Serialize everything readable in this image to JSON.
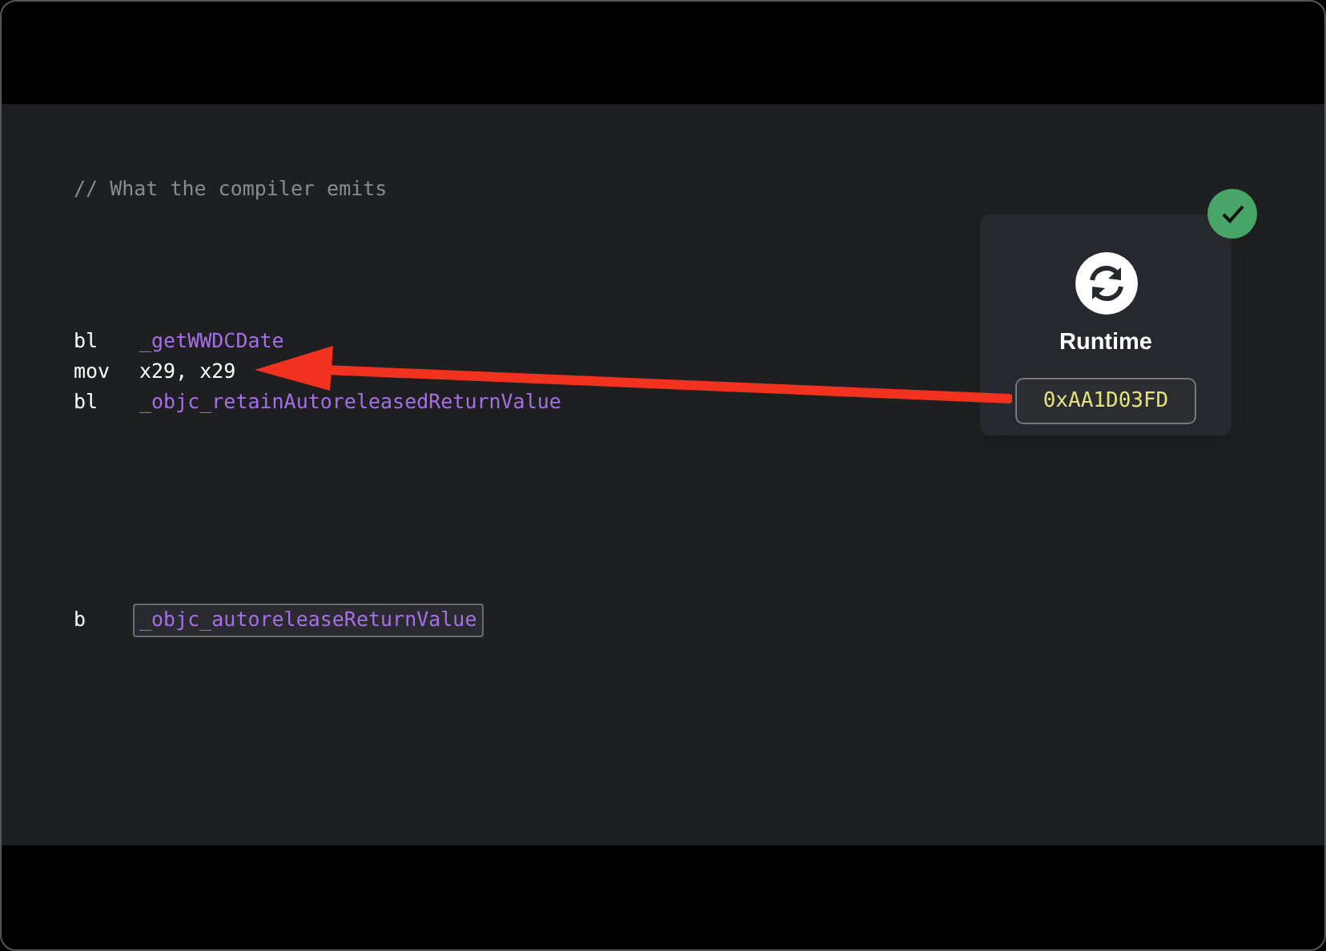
{
  "comment": "// What the compiler emits",
  "code_blocks": [
    {
      "lines": [
        {
          "mnemonic": "bl",
          "operand": "_getWWDCDate",
          "kind": "symbol",
          "highlighted": false
        },
        {
          "mnemonic": "mov",
          "operand": "x29, x29",
          "kind": "register",
          "highlighted": false
        },
        {
          "mnemonic": "bl",
          "operand": "_objc_retainAutoreleasedReturnValue",
          "kind": "symbol",
          "highlighted": false
        }
      ]
    },
    {
      "lines": [
        {
          "mnemonic": "b",
          "operand": "_objc_autoreleaseReturnValue",
          "kind": "symbol",
          "highlighted": true
        }
      ]
    }
  ],
  "runtime_card": {
    "title": "Runtime",
    "value": "0xAA1D03FD",
    "checked": true
  }
}
